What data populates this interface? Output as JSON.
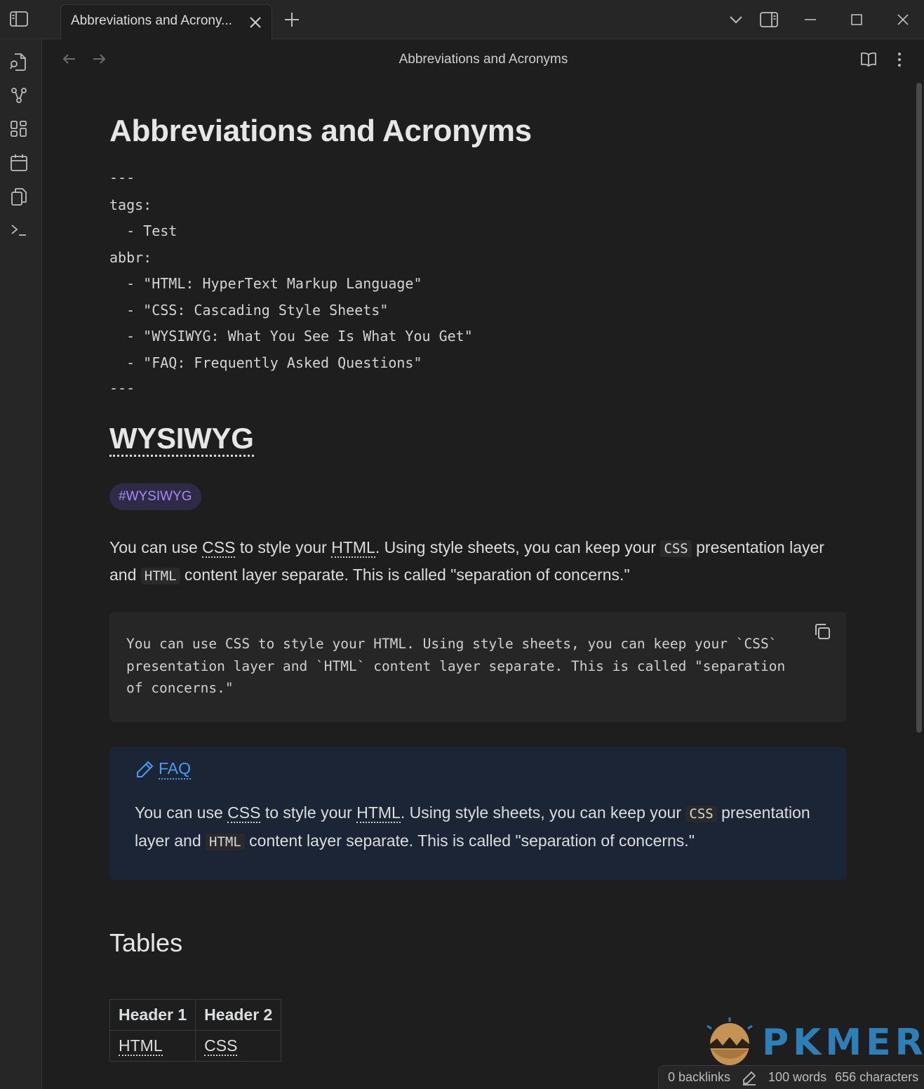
{
  "tab": {
    "title": "Abbreviations and Acrony..."
  },
  "view": {
    "title": "Abbreviations and Acronyms"
  },
  "note": {
    "title": "Abbreviations and Acronyms",
    "frontmatter": [
      "---",
      "tags:",
      "  - Test",
      "abbr:",
      "  - \"HTML: HyperText Markup Language\"",
      "  - \"CSS: Cascading Style Sheets\"",
      "  - \"WYSIWYG: What You See Is What You Get\"",
      "  - \"FAQ: Frequently Asked Questions\"",
      "---"
    ],
    "h2": "WYSIWYG",
    "tag": "#WYSIWYG",
    "para": {
      "p1": "You can use ",
      "css": "CSS",
      "p2": " to style your ",
      "html": "HTML",
      "p3": ". Using style sheets, you can keep your ",
      "css_code": "CSS",
      "p4": " presentation layer and ",
      "html_code": "HTML",
      "p5": " content layer separate. This is called \"separation of concerns.\""
    },
    "codeblock": "You can use CSS to style your HTML. Using style sheets, you can keep your `CSS`\npresentation layer and `HTML` content layer separate. This is called \"separation\nof concerns.\"",
    "callout": {
      "title": "FAQ",
      "p1": "You can use ",
      "css": "CSS",
      "p2": " to style your ",
      "html": "HTML",
      "p3": ". Using style sheets, you can keep your ",
      "css_code": "CSS",
      "p4": " presentation layer and ",
      "html_code": "HTML",
      "p5": " content layer separate. This is called \"separation of concerns.\""
    },
    "h3": "Tables",
    "table": {
      "headers": [
        "Header 1",
        "Header 2"
      ],
      "rows": [
        [
          "HTML",
          "CSS"
        ]
      ]
    }
  },
  "watermark": "PKMER",
  "status": {
    "backlinks": "0 backlinks",
    "words": "100 words",
    "characters": "656 characters"
  },
  "icons": [
    "sidebar-toggle-icon",
    "close-icon",
    "plus-icon",
    "chevron-down-icon",
    "split-pane-icon",
    "minimize-icon",
    "maximize-icon",
    "window-close-icon",
    "open-quick-switcher-icon",
    "graph-view-icon",
    "canvas-icon",
    "daily-note-icon",
    "templates-icon",
    "command-palette-icon",
    "back-arrow-icon",
    "forward-arrow-icon",
    "reading-view-icon",
    "more-options-icon",
    "copy-icon",
    "pencil-icon",
    "edit-icon"
  ],
  "colors": {
    "accent": "#a68af9",
    "link": "#4a9cf3",
    "callout_bg": "#1b2535",
    "background": "#1e1e1e"
  }
}
